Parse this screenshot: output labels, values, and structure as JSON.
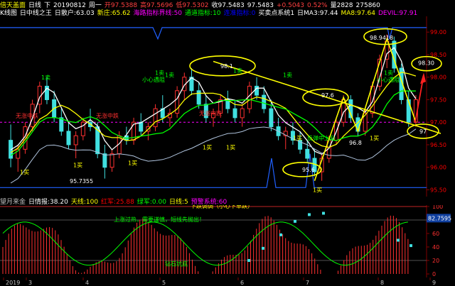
{
  "header": {
    "stock_name": "倍天盖面",
    "period": "日线",
    "arrow": "下",
    "date": "20190812",
    "weekday": "周一",
    "open_label": "开",
    "open": "97.5388",
    "high_label": "高",
    "high": "97.5696",
    "low_label": "低",
    "low": "97.5302",
    "close_label": "收",
    "close": "97.5483",
    "last": "97.5483",
    "change": "+0.5043",
    "change_pct": "0.52%",
    "volume_label": "量",
    "volume": "2828",
    "amount_label": "额",
    "amount": "275860"
  },
  "indicator_bar": [
    {
      "text": "K线图",
      "color": "#ffffff"
    },
    {
      "text": "日中线之王",
      "color": "#ffffff"
    },
    {
      "text": "日散户:63.03",
      "color": "#ffffff"
    },
    {
      "text": "新庄:65.62",
      "color": "#ffff00"
    },
    {
      "text": "海路指标界线:50",
      "color": "#ff00ff"
    },
    {
      "text": "通道指标:10",
      "color": "#00ff00"
    },
    {
      "text": "连准指标:0",
      "color": "#0000ff"
    },
    {
      "text": "买卖点系统1",
      "color": "#ffffff"
    },
    {
      "text": "日MA3:97.44",
      "color": "#ffffff"
    },
    {
      "text": "MA8:97.64",
      "color": "#ffff00"
    },
    {
      "text": "DEVIL:97.91",
      "color": "#ff00ff"
    }
  ],
  "sub_header": [
    {
      "text": "望月来金",
      "color": "#c0c0c0"
    },
    {
      "text": "日情报:38.20",
      "color": "#ffffff"
    },
    {
      "text": "天线:100",
      "color": "#ffff00"
    },
    {
      "text": "红军:25.88",
      "color": "#ff0000"
    },
    {
      "text": "绿军:0.00",
      "color": "#00ff00"
    },
    {
      "text": "日线:5",
      "color": "#ffff00"
    },
    {
      "text": "预警系统:60",
      "color": "#ff00ff"
    }
  ],
  "price_axis": [
    "99.00",
    "98.50",
    "98.00",
    "97.50",
    "97.00",
    "96.50",
    "96.00",
    "95.50"
  ],
  "price_axis_colors": [
    "#ff0000",
    "#ff0000",
    "#ff0000",
    "#ff0000",
    "#ff0000",
    "#ff0000",
    "#ff0000",
    "#ff0000"
  ],
  "sub_axis": [
    "100",
    "80",
    "60",
    "40",
    "20",
    "0"
  ],
  "sub_value": "82.7595",
  "date_axis": [
    "2019",
    "3",
    "4",
    "5",
    "6",
    "7",
    "8",
    "9"
  ],
  "annotations": {
    "labels_yellow": [
      "98.1",
      "97.6",
      "98.9418",
      "98.30",
      "97",
      "96.8",
      "95.6"
    ],
    "low_label": "95.7355",
    "buy_labels": [
      "1买",
      "1买",
      "1买",
      "1买",
      "1买",
      "1买",
      "1买",
      "1买"
    ],
    "sell_labels": [
      "1卖",
      "1卖",
      "1卖",
      "1卖",
      "1卖",
      "1卖"
    ],
    "trend_labels_red": [
      "无涨中跌",
      "无涨中跌",
      "无涨中跌"
    ],
    "green_note": "小心遇阻",
    "green_note2": "小心遇阻",
    "pullback_label": "反弹中上升",
    "sub_note1": "下跌调调（小心下单跌）",
    "sub_note2": "上涨过热，需要谨慎，短线先抛出！",
    "sub_note3": "钻石坑底"
  },
  "chart_data": {
    "type": "candlestick",
    "title": "",
    "ylim": [
      95.35,
      99.35
    ],
    "x_labels": [
      "2019",
      "3",
      "4",
      "5",
      "6",
      "7",
      "8",
      "9"
    ],
    "candles": [
      {
        "o": 96.6,
        "h": 96.95,
        "l": 96.0,
        "c": 96.2
      },
      {
        "o": 96.2,
        "h": 96.5,
        "l": 95.9,
        "c": 96.4
      },
      {
        "o": 96.4,
        "h": 97.0,
        "l": 96.3,
        "c": 96.9
      },
      {
        "o": 96.9,
        "h": 97.5,
        "l": 96.8,
        "c": 97.4
      },
      {
        "o": 97.4,
        "h": 97.9,
        "l": 97.2,
        "c": 97.8
      },
      {
        "o": 97.8,
        "h": 98.0,
        "l": 97.4,
        "c": 97.5
      },
      {
        "o": 97.5,
        "h": 97.7,
        "l": 97.0,
        "c": 97.1
      },
      {
        "o": 97.1,
        "h": 97.3,
        "l": 96.7,
        "c": 96.8
      },
      {
        "o": 96.8,
        "h": 97.0,
        "l": 96.4,
        "c": 96.5
      },
      {
        "o": 96.5,
        "h": 96.8,
        "l": 96.2,
        "c": 96.7
      },
      {
        "o": 96.7,
        "h": 97.1,
        "l": 96.6,
        "c": 97.0
      },
      {
        "o": 97.0,
        "h": 97.3,
        "l": 96.8,
        "c": 96.9
      },
      {
        "o": 96.9,
        "h": 97.0,
        "l": 96.2,
        "c": 96.3
      },
      {
        "o": 96.3,
        "h": 96.5,
        "l": 95.75,
        "c": 96.0
      },
      {
        "o": 96.0,
        "h": 96.4,
        "l": 95.9,
        "c": 96.3
      },
      {
        "o": 96.3,
        "h": 96.8,
        "l": 96.2,
        "c": 96.7
      },
      {
        "o": 96.7,
        "h": 96.9,
        "l": 96.5,
        "c": 96.6
      },
      {
        "o": 96.6,
        "h": 97.1,
        "l": 96.5,
        "c": 97.0
      },
      {
        "o": 97.0,
        "h": 97.2,
        "l": 96.7,
        "c": 96.8
      },
      {
        "o": 96.8,
        "h": 97.0,
        "l": 96.6,
        "c": 96.9
      },
      {
        "o": 96.9,
        "h": 97.4,
        "l": 96.8,
        "c": 97.3
      },
      {
        "o": 97.3,
        "h": 97.6,
        "l": 97.0,
        "c": 97.1
      },
      {
        "o": 97.1,
        "h": 97.3,
        "l": 96.9,
        "c": 97.2
      },
      {
        "o": 97.2,
        "h": 97.8,
        "l": 97.1,
        "c": 97.7
      },
      {
        "o": 97.7,
        "h": 98.1,
        "l": 97.5,
        "c": 98.0
      },
      {
        "o": 98.0,
        "h": 98.2,
        "l": 97.6,
        "c": 97.7
      },
      {
        "o": 97.7,
        "h": 97.9,
        "l": 97.3,
        "c": 97.4
      },
      {
        "o": 97.4,
        "h": 97.6,
        "l": 97.0,
        "c": 97.1
      },
      {
        "o": 97.1,
        "h": 97.3,
        "l": 96.9,
        "c": 97.2
      },
      {
        "o": 97.2,
        "h": 97.6,
        "l": 97.1,
        "c": 97.5
      },
      {
        "o": 97.5,
        "h": 97.7,
        "l": 97.2,
        "c": 97.3
      },
      {
        "o": 97.3,
        "h": 97.5,
        "l": 97.0,
        "c": 97.1
      },
      {
        "o": 97.1,
        "h": 97.4,
        "l": 96.9,
        "c": 97.3
      },
      {
        "o": 97.3,
        "h": 97.9,
        "l": 97.2,
        "c": 97.8
      },
      {
        "o": 97.8,
        "h": 98.0,
        "l": 97.5,
        "c": 97.6
      },
      {
        "o": 97.6,
        "h": 97.8,
        "l": 97.2,
        "c": 97.3
      },
      {
        "o": 97.3,
        "h": 97.5,
        "l": 96.8,
        "c": 96.9
      },
      {
        "o": 96.9,
        "h": 97.1,
        "l": 96.6,
        "c": 96.7
      },
      {
        "o": 96.7,
        "h": 96.9,
        "l": 96.4,
        "c": 96.8
      },
      {
        "o": 96.8,
        "h": 97.0,
        "l": 96.5,
        "c": 96.6
      },
      {
        "o": 96.6,
        "h": 96.8,
        "l": 96.3,
        "c": 96.4
      },
      {
        "o": 96.4,
        "h": 96.6,
        "l": 96.1,
        "c": 96.2
      },
      {
        "o": 96.2,
        "h": 96.4,
        "l": 95.8,
        "c": 95.9
      },
      {
        "o": 95.9,
        "h": 96.3,
        "l": 95.7,
        "c": 96.2
      },
      {
        "o": 96.2,
        "h": 96.7,
        "l": 96.1,
        "c": 96.6
      },
      {
        "o": 96.6,
        "h": 97.1,
        "l": 96.5,
        "c": 97.0
      },
      {
        "o": 97.0,
        "h": 97.6,
        "l": 96.9,
        "c": 97.5
      },
      {
        "o": 97.5,
        "h": 97.6,
        "l": 97.0,
        "c": 97.1
      },
      {
        "o": 97.1,
        "h": 97.2,
        "l": 96.7,
        "c": 96.8
      },
      {
        "o": 96.8,
        "h": 97.3,
        "l": 96.7,
        "c": 97.2
      },
      {
        "o": 97.2,
        "h": 97.9,
        "l": 97.1,
        "c": 97.8
      },
      {
        "o": 97.8,
        "h": 98.5,
        "l": 97.7,
        "c": 98.4
      },
      {
        "o": 98.4,
        "h": 98.95,
        "l": 98.2,
        "c": 98.8
      },
      {
        "o": 98.8,
        "h": 98.9,
        "l": 98.1,
        "c": 98.2
      },
      {
        "o": 98.2,
        "h": 98.3,
        "l": 97.4,
        "c": 97.5
      },
      {
        "o": 97.5,
        "h": 97.7,
        "l": 96.9,
        "c": 97.0
      },
      {
        "o": 97.0,
        "h": 97.6,
        "l": 96.9,
        "c": 97.5
      }
    ],
    "series": [
      {
        "name": "MA3",
        "color": "#ffffff"
      },
      {
        "name": "MA8",
        "color": "#ffff00"
      },
      {
        "name": "DEVIL",
        "color": "#ff00ff"
      }
    ],
    "sub_ylim": [
      0,
      100
    ]
  }
}
